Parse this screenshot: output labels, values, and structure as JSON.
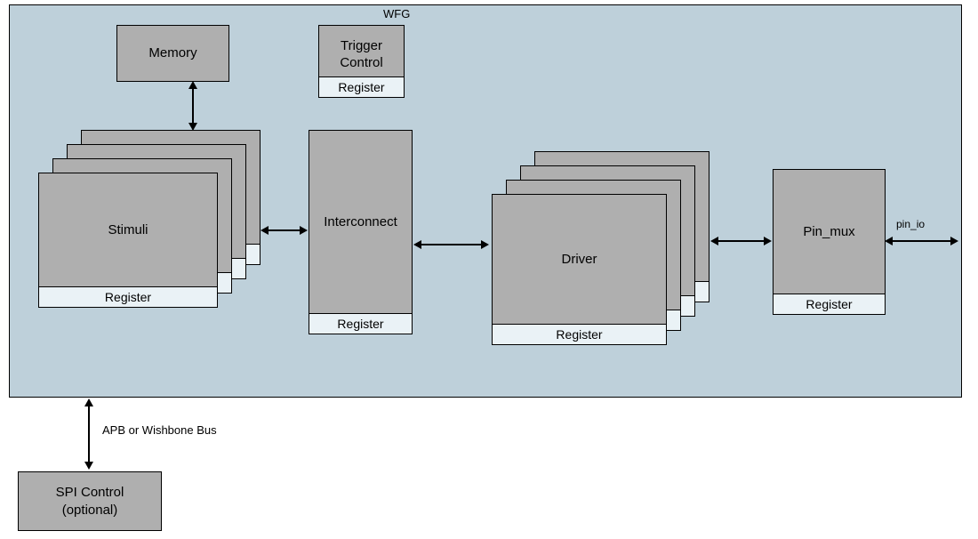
{
  "container": {
    "label": "WFG"
  },
  "blocks": {
    "memory": {
      "label": "Memory"
    },
    "trigger": {
      "label_line1": "Trigger",
      "label_line2": "Control",
      "footer": "Register"
    },
    "stimuli": {
      "label": "Stimuli",
      "footer": "Register"
    },
    "interconnect": {
      "label": "Interconnect",
      "footer": "Register"
    },
    "driver": {
      "label": "Driver",
      "footer": "Register"
    },
    "pinmux": {
      "label": "Pin_mux",
      "footer": "Register"
    },
    "spi": {
      "label_line1": "SPI Control",
      "label_line2": "(optional)"
    }
  },
  "labels": {
    "bus": "APB or Wishbone Bus",
    "pin_io": "pin_io"
  }
}
